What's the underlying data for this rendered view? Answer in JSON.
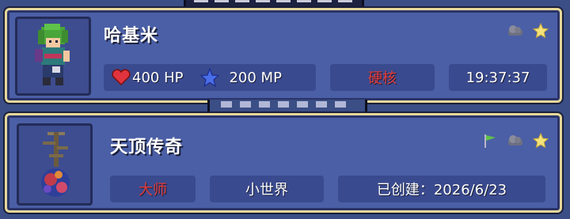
{
  "character": {
    "name": "哈基米",
    "hp": "400 HP",
    "mp": "200 MP",
    "difficulty": "硬核",
    "playtime": "19:37:37"
  },
  "world": {
    "name": "天顶传奇",
    "difficulty": "大师",
    "size": "小世界",
    "created": "已创建：2026/6/23"
  },
  "colors": {
    "panel": "#4b5fa6",
    "border": "#e6d79a",
    "cell": "#3a4a8e",
    "red": "#e23b3b",
    "star": "#f4e27a"
  },
  "icons": [
    "cloud-icon",
    "star-icon",
    "flag-icon",
    "heart-icon",
    "mana-star-icon"
  ]
}
